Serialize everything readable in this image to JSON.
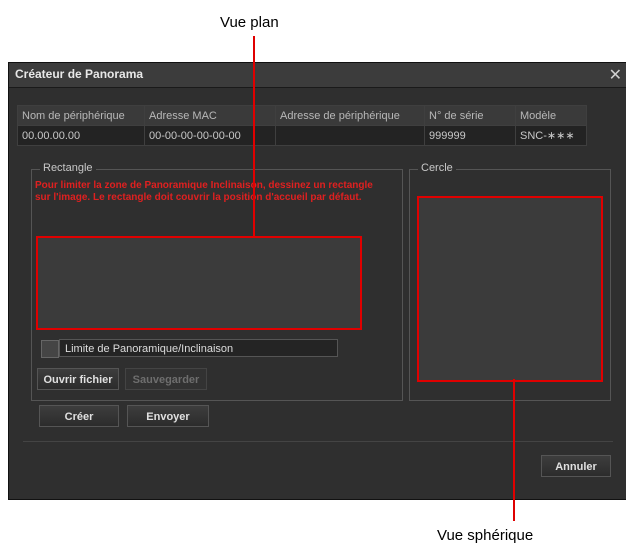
{
  "callouts": {
    "top": "Vue plan",
    "bottom": "Vue sphérique",
    "line_color": "#e00000"
  },
  "window": {
    "title": "Créateur de Panorama",
    "close_icon": "close-icon"
  },
  "device_table": {
    "columns": [
      "Nom de périphérique",
      "Adresse MAC",
      "Adresse de périphérique",
      "N° de série",
      "Modèle"
    ],
    "rows": [
      [
        "00.00.00.00",
        "00-00-00-00-00-00",
        "",
        "999999",
        "SNC-∗∗∗"
      ]
    ]
  },
  "rectangle_group": {
    "label": "Rectangle",
    "warning": "Pour limiter la zone de Panoramique Inclinaison, dessinez un rectangle sur l'image. Le rectangle doit couvrir la position d'accueil par défaut.",
    "checkbox_label": "Limite de Panoramique/Inclinaison",
    "checkbox_checked": false,
    "open_button": "Ouvrir fichier",
    "save_button": "Sauvegarder"
  },
  "circle_group": {
    "label": "Cercle"
  },
  "actions": {
    "create": "Créer",
    "send": "Envoyer",
    "cancel": "Annuler"
  },
  "colors": {
    "dialog_bg": "#2f2f2f",
    "warning_text": "#e02020",
    "highlight_border": "#e00000"
  }
}
